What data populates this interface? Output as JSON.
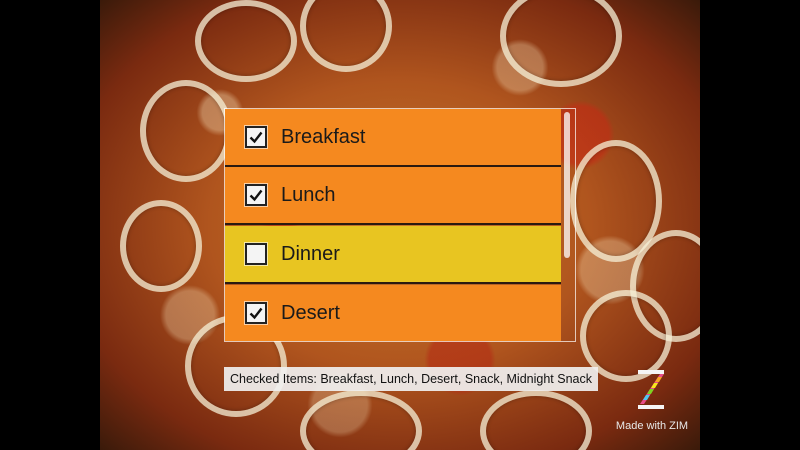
{
  "list": {
    "items": [
      {
        "label": "Breakfast",
        "checked": true,
        "selected": false
      },
      {
        "label": "Lunch",
        "checked": true,
        "selected": false
      },
      {
        "label": "Dinner",
        "checked": false,
        "selected": true
      },
      {
        "label": "Desert",
        "checked": true,
        "selected": false
      }
    ],
    "row_color": "#f5891f",
    "selected_color": "#e8c521"
  },
  "status": {
    "text": "Checked Items: Breakfast, Lunch, Desert, Snack, Midnight Snack"
  },
  "branding": {
    "text": "Made with ZIM",
    "logo_icon": "zim-logo-icon"
  }
}
